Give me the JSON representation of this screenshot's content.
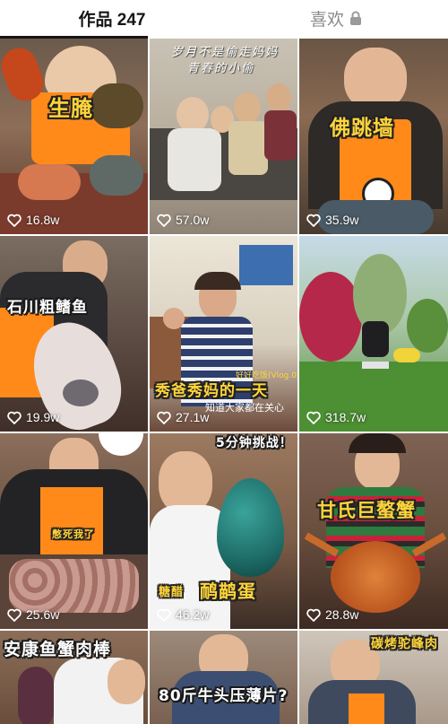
{
  "tabs": {
    "works": "作品 247",
    "likes": "喜欢"
  },
  "videos": [
    {
      "caption": "生腌",
      "likes": "16.8w"
    },
    {
      "caption": "岁月不是偷走妈妈",
      "caption2": "青春的小偷",
      "likes": "57.0w"
    },
    {
      "caption": "佛跳墙",
      "likes": "35.9w"
    },
    {
      "caption": "石川粗鳍鱼",
      "likes": "19.9w"
    },
    {
      "caption": "秀爸秀妈的一天",
      "caption_top": "好好吃饭(Vlog.02)",
      "caption_sub": "知道大家都在关心",
      "likes": "27.1w"
    },
    {
      "caption": "",
      "likes": "318.7w"
    },
    {
      "caption": "憋死我了",
      "likes": "25.6w"
    },
    {
      "caption": "5分钟挑战！",
      "caption2": "糖醋",
      "caption3": "鸸鹋蛋",
      "likes": "46.2w"
    },
    {
      "caption": "甘氏巨螯蟹",
      "likes": "28.8w"
    },
    {
      "caption": "安康鱼蟹肉棒"
    },
    {
      "caption": "80斤牛头压薄片?"
    },
    {
      "caption": "碳烤驼峰肉"
    }
  ],
  "colors": {
    "heart": "#ffffff",
    "caption_yellow": "#ffd53a"
  }
}
